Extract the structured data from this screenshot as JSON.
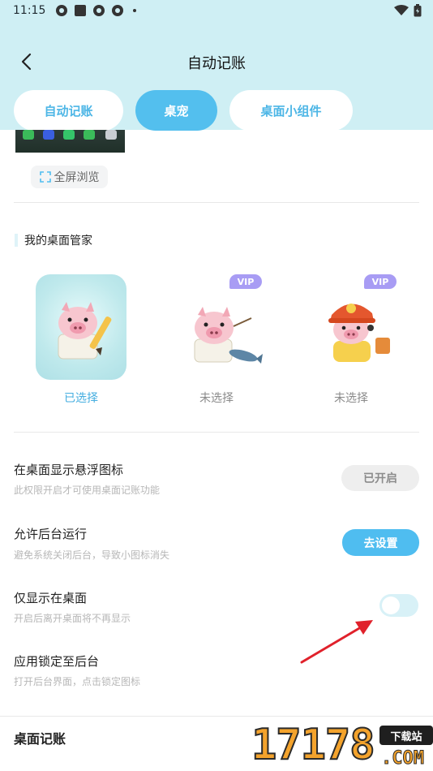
{
  "status_bar": {
    "time": "11:15"
  },
  "header": {
    "title": "自动记账",
    "back_icon": "chevron-left-icon"
  },
  "tabs": [
    {
      "label": "自动记账",
      "active": false
    },
    {
      "label": "桌宠",
      "active": true
    },
    {
      "label": "桌面小组件",
      "active": false
    }
  ],
  "preview": {
    "fullscreen_label": "全屏浏览",
    "fullscreen_icon": "fullscreen-icon"
  },
  "pet_section": {
    "title": "我的桌面管家",
    "pets": [
      {
        "label": "已选择",
        "vip": "",
        "selected": true
      },
      {
        "label": "未选择",
        "vip": "VIP",
        "selected": false
      },
      {
        "label": "未选择",
        "vip": "VIP",
        "selected": false
      }
    ]
  },
  "settings": [
    {
      "title": "在桌面显示悬浮图标",
      "subtitle": "此权限开启才可使用桌面记账功能",
      "button": "已开启"
    },
    {
      "title": "允许后台运行",
      "subtitle": "避免系统关闭后台，导致小图标消失",
      "button": "去设置"
    },
    {
      "title": "仅显示在桌面",
      "subtitle": "开启后离开桌面将不再显示",
      "toggle_on": false
    },
    {
      "title": "应用锁定至后台",
      "subtitle": "打开后台界面，点击锁定图标"
    }
  ],
  "bottom_section": {
    "title": "桌面记账"
  },
  "watermark": {
    "number": "17178",
    "tag": "下载站",
    "suffix": ".COM"
  },
  "colors": {
    "header_bg": "#cfeff4",
    "accent": "#53bfee",
    "vip": "#a89cf4",
    "arrow": "#e0212b"
  }
}
